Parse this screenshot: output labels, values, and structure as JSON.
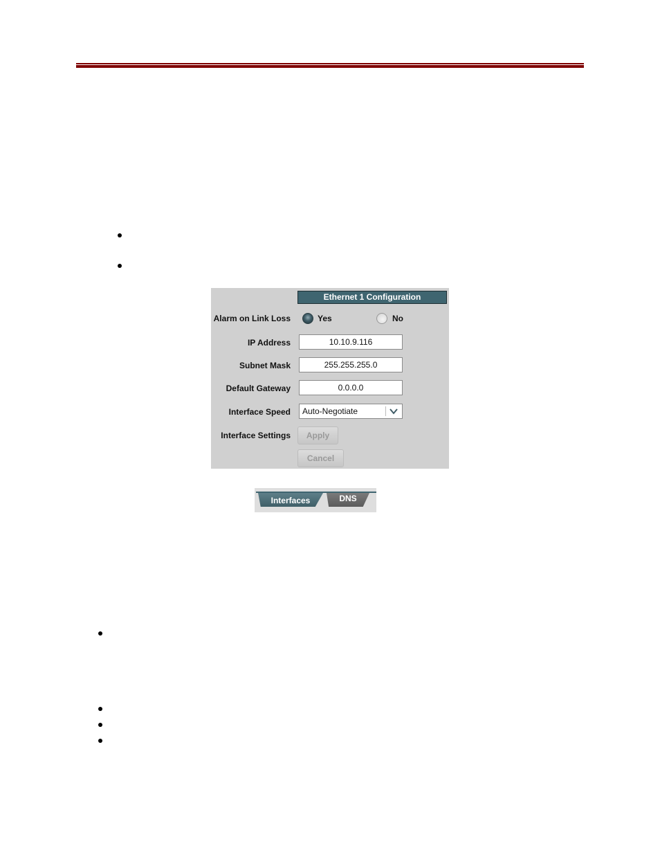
{
  "document": {
    "header_rule_color": "#7f0000",
    "bullet_groups": [
      {
        "count": 2
      },
      {
        "count": 1
      },
      {
        "count": 3
      }
    ]
  },
  "ethernet_panel": {
    "title": "Ethernet 1 Configuration",
    "alarm_label": "Alarm on Link Loss",
    "alarm_options": [
      {
        "label": "Yes",
        "selected": true
      },
      {
        "label": "No",
        "selected": false
      }
    ],
    "ip_label": "IP Address",
    "ip_value": "10.10.9.116",
    "subnet_label": "Subnet Mask",
    "subnet_value": "255.255.255.0",
    "gateway_label": "Default Gateway",
    "gateway_value": "0.0.0.0",
    "speed_label": "Interface Speed",
    "speed_value": "Auto-Negotiate",
    "settings_label": "Interface Settings",
    "apply_label": "Apply",
    "cancel_label": "Cancel",
    "header_color": "#3f6570"
  },
  "tabs": {
    "items": [
      {
        "label": "Interfaces",
        "active": true
      },
      {
        "label": "DNS",
        "active": false
      }
    ]
  }
}
